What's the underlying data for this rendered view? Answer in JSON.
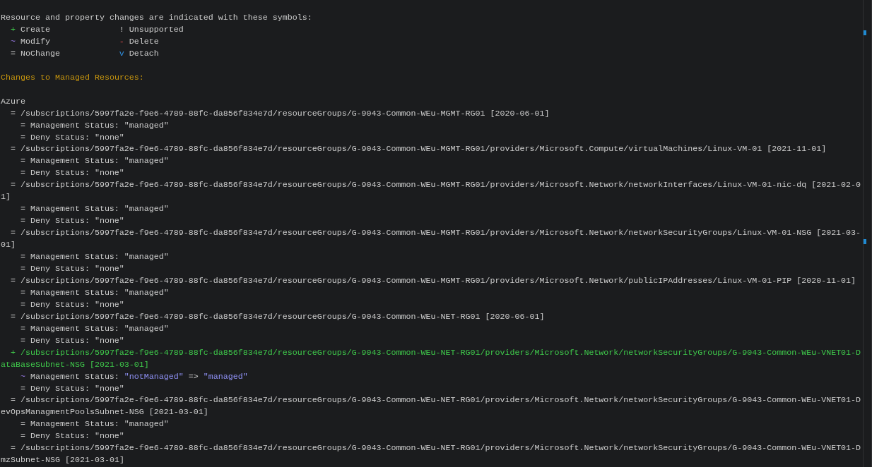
{
  "legend": {
    "heading": "Resource and property changes are indicated with these symbols:",
    "items": [
      {
        "kind": "create",
        "symbol": "+",
        "label": "Create"
      },
      {
        "kind": "unsupported",
        "symbol": "!",
        "label": "Unsupported"
      },
      {
        "kind": "modify",
        "symbol": "~",
        "label": "Modify"
      },
      {
        "kind": "delete",
        "symbol": "-",
        "label": "Delete"
      },
      {
        "kind": "nochange",
        "symbol": "=",
        "label": "NoChange"
      },
      {
        "kind": "detach",
        "symbol": "v",
        "label": "Detach"
      }
    ]
  },
  "section_heading": "Changes to Managed Resources:",
  "provider": "Azure",
  "resources": [
    {
      "kind": "nochange",
      "symbol": "=",
      "path": "/subscriptions/5997fa2e-f9e6-4789-88fc-da856f834e7d/resourceGroups/G-9043-Common-WEu-MGMT-RG01",
      "api_version": "[2020-06-01]",
      "properties": [
        {
          "kind": "nochange",
          "symbol": "=",
          "name": "Management Status:",
          "value": "\"managed\""
        },
        {
          "kind": "nochange",
          "symbol": "=",
          "name": "Deny Status:",
          "value": "\"none\""
        }
      ]
    },
    {
      "kind": "nochange",
      "symbol": "=",
      "path": "/subscriptions/5997fa2e-f9e6-4789-88fc-da856f834e7d/resourceGroups/G-9043-Common-WEu-MGMT-RG01/providers/Microsoft.Compute/virtualMachines/Linux-VM-01",
      "api_version": "[2021-11-01]",
      "properties": [
        {
          "kind": "nochange",
          "symbol": "=",
          "name": "Management Status:",
          "value": "\"managed\""
        },
        {
          "kind": "nochange",
          "symbol": "=",
          "name": "Deny Status:",
          "value": "\"none\""
        }
      ]
    },
    {
      "kind": "nochange",
      "symbol": "=",
      "path": "/subscriptions/5997fa2e-f9e6-4789-88fc-da856f834e7d/resourceGroups/G-9043-Common-WEu-MGMT-RG01/providers/Microsoft.Network/networkInterfaces/Linux-VM-01-nic-dq",
      "api_version": "[2021-02-01]",
      "properties": [
        {
          "kind": "nochange",
          "symbol": "=",
          "name": "Management Status:",
          "value": "\"managed\""
        },
        {
          "kind": "nochange",
          "symbol": "=",
          "name": "Deny Status:",
          "value": "\"none\""
        }
      ]
    },
    {
      "kind": "nochange",
      "symbol": "=",
      "path": "/subscriptions/5997fa2e-f9e6-4789-88fc-da856f834e7d/resourceGroups/G-9043-Common-WEu-MGMT-RG01/providers/Microsoft.Network/networkSecurityGroups/Linux-VM-01-NSG",
      "api_version": "[2021-03-01]",
      "properties": [
        {
          "kind": "nochange",
          "symbol": "=",
          "name": "Management Status:",
          "value": "\"managed\""
        },
        {
          "kind": "nochange",
          "symbol": "=",
          "name": "Deny Status:",
          "value": "\"none\""
        }
      ]
    },
    {
      "kind": "nochange",
      "symbol": "=",
      "path": "/subscriptions/5997fa2e-f9e6-4789-88fc-da856f834e7d/resourceGroups/G-9043-Common-WEu-MGMT-RG01/providers/Microsoft.Network/publicIPAddresses/Linux-VM-01-PIP",
      "api_version": "[2020-11-01]",
      "properties": [
        {
          "kind": "nochange",
          "symbol": "=",
          "name": "Management Status:",
          "value": "\"managed\""
        },
        {
          "kind": "nochange",
          "symbol": "=",
          "name": "Deny Status:",
          "value": "\"none\""
        }
      ]
    },
    {
      "kind": "nochange",
      "symbol": "=",
      "path": "/subscriptions/5997fa2e-f9e6-4789-88fc-da856f834e7d/resourceGroups/G-9043-Common-WEu-NET-RG01",
      "api_version": "[2020-06-01]",
      "properties": [
        {
          "kind": "nochange",
          "symbol": "=",
          "name": "Management Status:",
          "value": "\"managed\""
        },
        {
          "kind": "nochange",
          "symbol": "=",
          "name": "Deny Status:",
          "value": "\"none\""
        }
      ]
    },
    {
      "kind": "create",
      "symbol": "+",
      "path": "/subscriptions/5997fa2e-f9e6-4789-88fc-da856f834e7d/resourceGroups/G-9043-Common-WEu-NET-RG01/providers/Microsoft.Network/networkSecurityGroups/G-9043-Common-WEu-VNET01-DataBaseSubnet-NSG",
      "api_version": "[2021-03-01]",
      "properties": [
        {
          "kind": "modify",
          "symbol": "~",
          "name": "Management Status:",
          "before": "\"notManaged\"",
          "arrow": "=>",
          "after": "\"managed\""
        },
        {
          "kind": "nochange",
          "symbol": "=",
          "name": "Deny Status:",
          "value": "\"none\""
        }
      ]
    },
    {
      "kind": "nochange",
      "symbol": "=",
      "path": "/subscriptions/5997fa2e-f9e6-4789-88fc-da856f834e7d/resourceGroups/G-9043-Common-WEu-NET-RG01/providers/Microsoft.Network/networkSecurityGroups/G-9043-Common-WEu-VNET01-DevOpsManagmentPoolsSubnet-NSG",
      "api_version": "[2021-03-01]",
      "properties": [
        {
          "kind": "nochange",
          "symbol": "=",
          "name": "Management Status:",
          "value": "\"managed\""
        },
        {
          "kind": "nochange",
          "symbol": "=",
          "name": "Deny Status:",
          "value": "\"none\""
        }
      ]
    },
    {
      "kind": "nochange",
      "symbol": "=",
      "path": "/subscriptions/5997fa2e-f9e6-4789-88fc-da856f834e7d/resourceGroups/G-9043-Common-WEu-NET-RG01/providers/Microsoft.Network/networkSecurityGroups/G-9043-Common-WEu-VNET01-DmzSubnet-NSG",
      "api_version": "[2021-03-01]"
    }
  ]
}
